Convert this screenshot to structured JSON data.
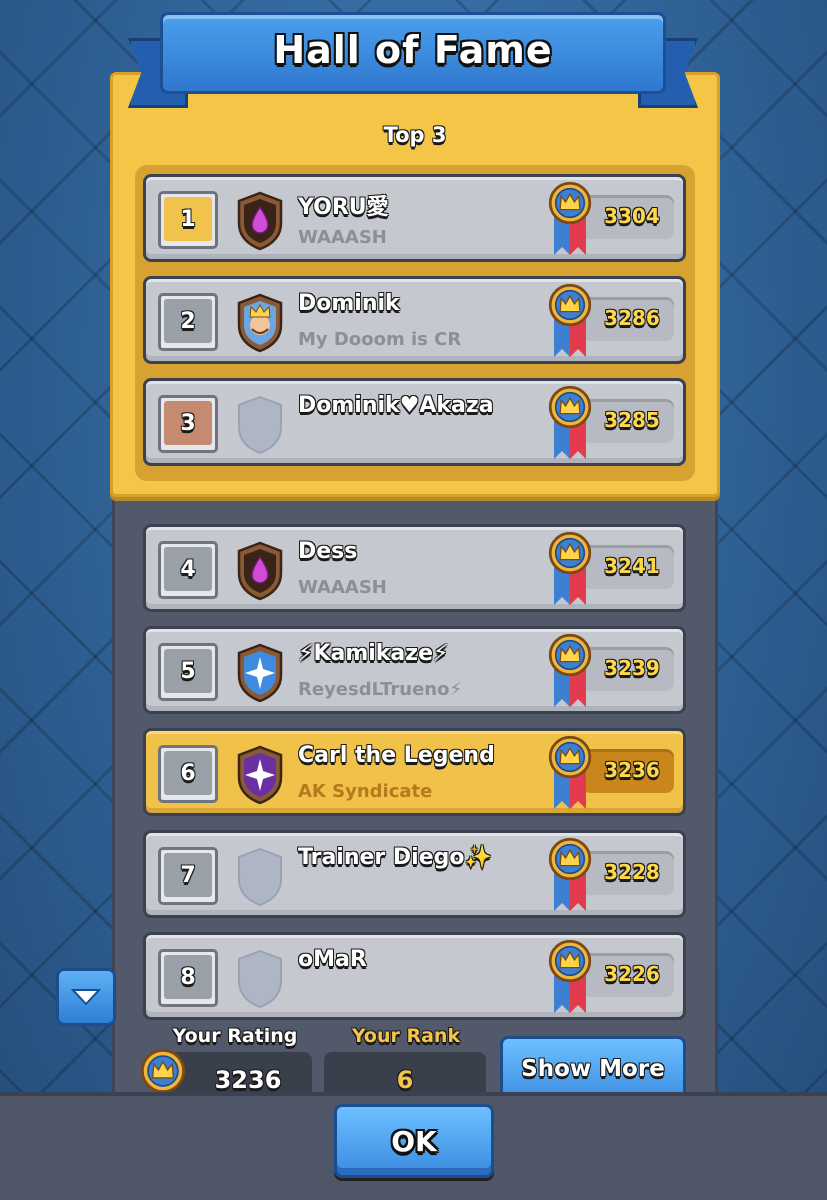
{
  "header": {
    "title": "Hall of Fame"
  },
  "top3": {
    "title": "Top 3",
    "rows": [
      {
        "rank": "1",
        "name": "YORU愛",
        "clan": "WAAASH",
        "score": "3304",
        "rank_style": "gold",
        "badge": "elixir-badge-icon"
      },
      {
        "rank": "2",
        "name": "Dominik",
        "clan": "My Dooom is CR",
        "score": "3286",
        "rank_style": "silver",
        "badge": "king-badge-icon"
      },
      {
        "rank": "3",
        "name": "Dominik♥Akaza",
        "clan": "",
        "score": "3285",
        "rank_style": "bronze",
        "badge": "empty-shield-icon"
      }
    ]
  },
  "leaderboard": {
    "rows": [
      {
        "rank": "4",
        "name": "Dess",
        "clan": "WAAASH",
        "score": "3241",
        "badge": "elixir-badge-icon",
        "highlight": false
      },
      {
        "rank": "5",
        "name": "⚡Kamikaze⚡",
        "clan": "ReyesdLTrueno⚡",
        "score": "3239",
        "badge": "star-badge-icon",
        "highlight": false
      },
      {
        "rank": "6",
        "name": "Carl the Legend",
        "clan": "AK Syndicate",
        "score": "3236",
        "badge": "purple-star-badge-icon",
        "highlight": true
      },
      {
        "rank": "7",
        "name": "Trainer Diego✨",
        "clan": "",
        "score": "3228",
        "badge": "empty-shield-icon",
        "highlight": false
      },
      {
        "rank": "8",
        "name": "oMaR",
        "clan": "",
        "score": "3226",
        "badge": "empty-shield-icon",
        "highlight": false
      }
    ]
  },
  "footer_info": {
    "your_rating_label": "Your Rating",
    "your_rating_value": "3236",
    "your_rank_label": "Your Rank",
    "your_rank_value": "6",
    "show_more_label": "Show More"
  },
  "ok_label": "OK",
  "colors": {
    "top3_gold": "#f5c547",
    "highlight_row": "#f0c24a",
    "score_text": "#ffd84a",
    "button_blue": "#3b8be0"
  }
}
